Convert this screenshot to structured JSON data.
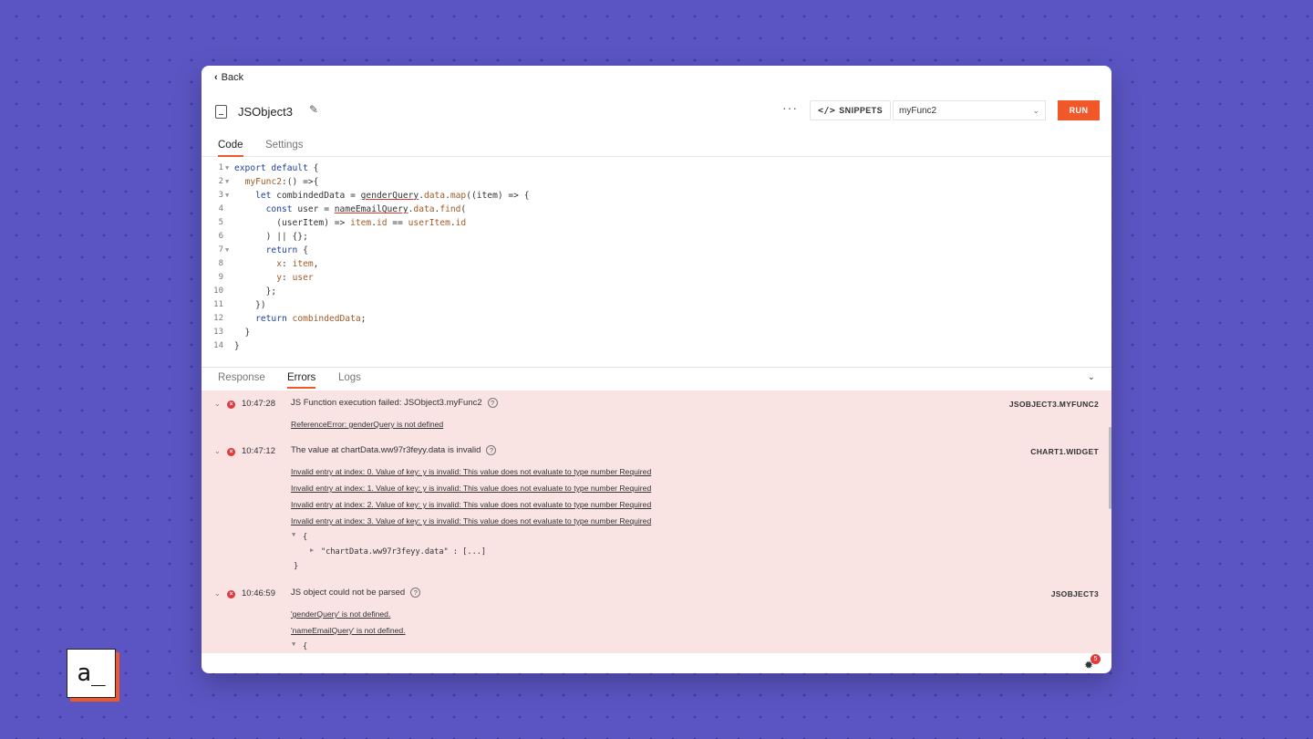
{
  "nav": {
    "back_label": "Back"
  },
  "header": {
    "title": "JSObject3",
    "snippets_label": "SNIPPETS",
    "selected_function": "myFunc2",
    "run_label": "RUN"
  },
  "tabs": [
    {
      "label": "Code"
    },
    {
      "label": "Settings"
    }
  ],
  "code_lines": [
    "1",
    "2",
    "3",
    "4",
    "5",
    "6",
    "7",
    "8",
    "9",
    "10",
    "11",
    "12",
    "13",
    "14"
  ],
  "bottom_tabs": [
    {
      "label": "Response"
    },
    {
      "label": "Errors"
    },
    {
      "label": "Logs"
    }
  ],
  "errors": [
    {
      "time": "10:47:28",
      "message": "JS Function execution failed: JSObject3.myFunc2",
      "source": "JSOBJECT3.MYFUNC2",
      "details": [
        "ReferenceError: genderQuery is not defined"
      ]
    },
    {
      "time": "10:47:12",
      "message": "The value at chartData.ww97r3feyy.data is invalid",
      "source": "CHART1.WIDGET",
      "details": [
        "Invalid entry at index: 0. Value of key: y is invalid: This value does not evaluate to type number Required",
        "Invalid entry at index: 1. Value of key: y is invalid: This value does not evaluate to type number Required",
        "Invalid entry at index: 2. Value of key: y is invalid: This value does not evaluate to type number Required",
        "Invalid entry at index: 3. Value of key: y is invalid: This value does not evaluate to type number Required"
      ],
      "json_open": "{",
      "json_key": "\"chartData.ww97r3feyy.data\" : [...]",
      "json_close": "}"
    },
    {
      "time": "10:46:59",
      "message": "JS object could not be parsed",
      "source": "JSOBJECT3",
      "details": [
        "'genderQuery' is not defined.",
        "'nameEmailQuery' is not defined."
      ],
      "json_open": "{"
    }
  ],
  "debugger": {
    "badge_count": "5"
  },
  "logo": {
    "text": "a_"
  },
  "colors": {
    "accent": "#f0582a",
    "error": "#e03a3a",
    "error_bg": "#f9e3e3",
    "background": "#5b55c4"
  }
}
